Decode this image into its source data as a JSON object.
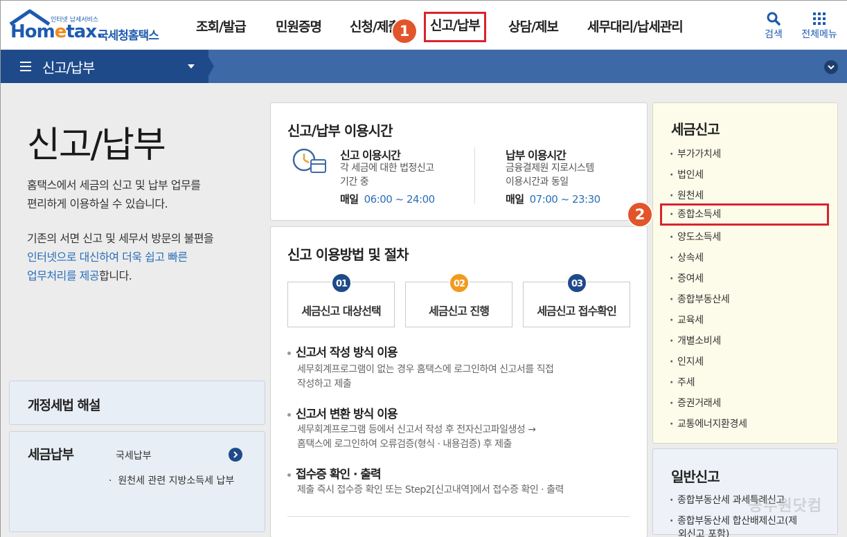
{
  "header": {
    "logo_brand_1": "Hom",
    "logo_brand_e": "e",
    "logo_brand_2": "tax.",
    "logo_tagline": "인터넷 납세서비스",
    "logo_org": "국세청홈택스",
    "nav": [
      {
        "label": "조회/발급"
      },
      {
        "label": "민원증명"
      },
      {
        "label": "신청/제출"
      },
      {
        "label": "신고/납부"
      },
      {
        "label": "상담/제보"
      },
      {
        "label": "세무대리/납세관리"
      }
    ],
    "search_label": "검색",
    "allmenu_label": "전체메뉴"
  },
  "annotations": {
    "step1": "1",
    "step2": "2"
  },
  "subbar": {
    "title": "신고/납부"
  },
  "intro": {
    "title": "신고/납부",
    "p1_line1": "홈택스에서 세금의 신고 및 납부 업무를",
    "p1_line2": "편리하게 이용하실 수 있습니다.",
    "p2_line1": "기존의 서면 신고 및 세무서 방문의 불편을",
    "p2_blue1": "인터넷으로 대신하여 더욱 쉽고 빠른",
    "p2_blue2": "업무처리를 제공",
    "p2_tail": "합니다."
  },
  "law": {
    "title": "개정세법 해설"
  },
  "payment": {
    "title": "세금납부",
    "items": [
      {
        "label": "국세납부"
      },
      {
        "label": "원천세 관련 지방소득세 납부"
      }
    ]
  },
  "hours": {
    "title": "신고/납부 이용시간",
    "report": {
      "title": "신고 이용시간",
      "desc1": "각 세금에 대한 법정신고",
      "desc2": "기간 중",
      "day": "매일",
      "time": "06:00 ~ 24:00"
    },
    "pay": {
      "title": "납부 이용시간",
      "desc1": "금융결제원 지로시스템",
      "desc2": "이용시간과 동일",
      "day": "매일",
      "time": "07:00 ~ 23:30"
    }
  },
  "procedure": {
    "title": "신고 이용방법 및 절차",
    "steps": [
      {
        "num": "01",
        "label": "세금신고 대상선택",
        "color": "#1e4a8a"
      },
      {
        "num": "02",
        "label": "세금신고 진행",
        "color": "#f29a1e"
      },
      {
        "num": "03",
        "label": "세금신고 접수확인",
        "color": "#1e4a8a"
      }
    ],
    "methods": [
      {
        "title": "신고서 작성 방식 이용",
        "desc1": "세무회계프로그램이 없는 경우 홈택스에 로그인하여 신고서를 직접",
        "desc2": "작성하고 제출"
      },
      {
        "title": "신고서 변환 방식 이용",
        "desc1": "세무회계프로그램 등에서 신고서 작성 후 전자신고파일생성 →",
        "desc2": "홈택스에 로그인하여 오류검증(형식 · 내용검증) 후 제출"
      },
      {
        "title": "접수증 확인 · 출력",
        "desc1": "제출 즉시 접수증 확인 또는 Step2[신고내역]에서 접수증 확인 · 출력",
        "desc2": ""
      }
    ]
  },
  "tax_report": {
    "title": "세금신고",
    "items": [
      {
        "label": "부가가치세"
      },
      {
        "label": "법인세"
      },
      {
        "label": "원천세"
      },
      {
        "label": "종합소득세"
      },
      {
        "label": "양도소득세"
      },
      {
        "label": "상속세"
      },
      {
        "label": "증여세"
      },
      {
        "label": "종합부동산세"
      },
      {
        "label": "교육세"
      },
      {
        "label": "개별소비세"
      },
      {
        "label": "인지세"
      },
      {
        "label": "주세"
      },
      {
        "label": "증권거래세"
      },
      {
        "label": "교통에너지환경세"
      }
    ]
  },
  "general_report": {
    "title": "일반신고",
    "items": [
      {
        "label": "종합부동산세 과세특례신고"
      },
      {
        "label": "종합부동산세 합산배제신고(제"
      },
      {
        "label": "외신고 포함)"
      }
    ]
  },
  "watermark": "공무원닷컴",
  "colors": {
    "brand_blue": "#1d5bb0",
    "highlight_red": "#d9232d",
    "badge_orange": "#e2552a"
  }
}
